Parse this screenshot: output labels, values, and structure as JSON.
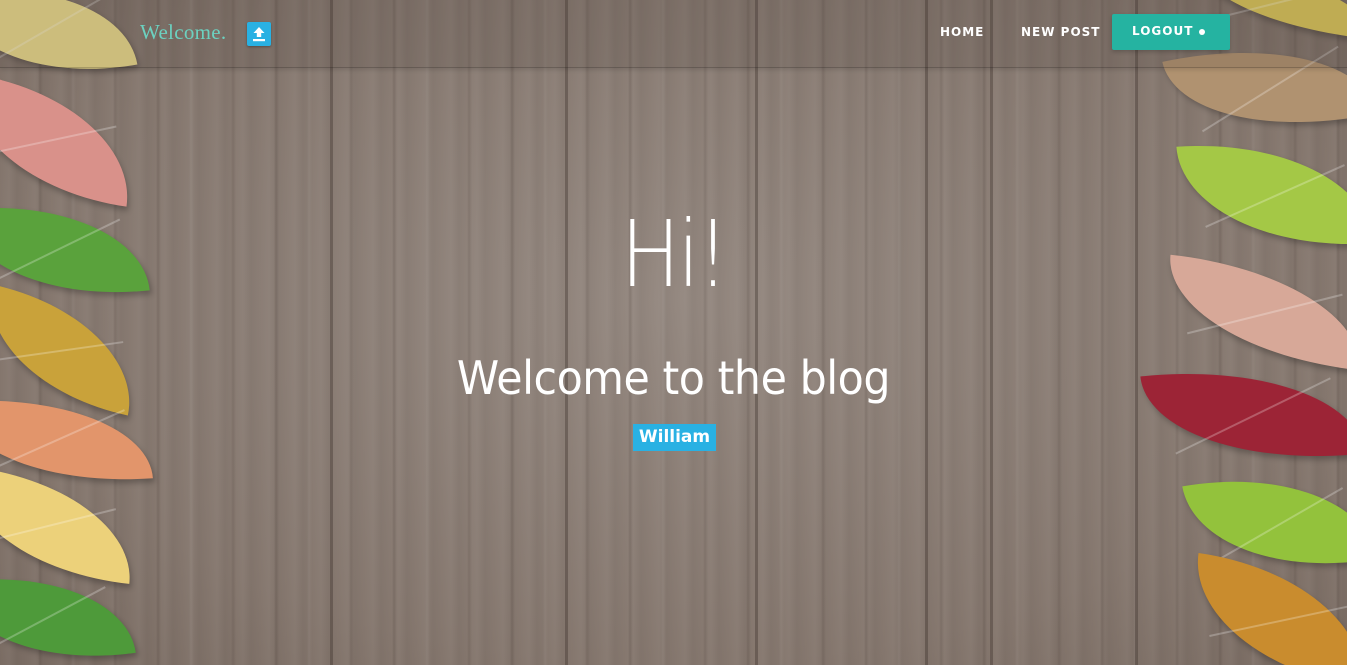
{
  "navbar": {
    "brand": "Welcome.",
    "upload_icon": "upload-icon",
    "links": [
      {
        "label": "HOME"
      },
      {
        "label": "NEW POST"
      }
    ],
    "logout_label": "LOGOUT"
  },
  "hero": {
    "greeting": "Hi!",
    "subtitle": "Welcome to the blog",
    "username": "William"
  },
  "colors": {
    "brand_text": "#6cd1c0",
    "accent_teal": "#25b3a1",
    "accent_blue": "#29b1e3"
  }
}
